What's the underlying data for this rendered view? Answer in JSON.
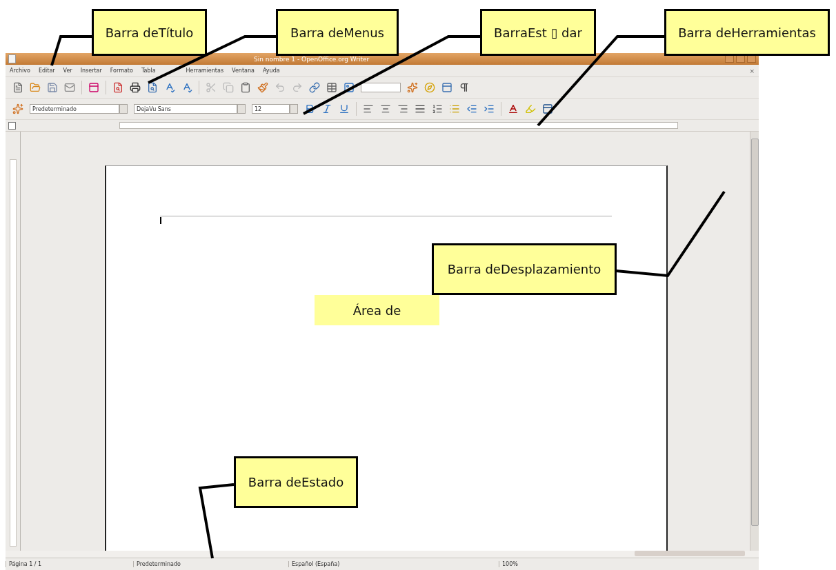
{
  "window": {
    "title": "Sin nombre 1 - OpenOffice.org Writer"
  },
  "menu_bar": {
    "items": [
      "Archivo",
      "Editar",
      "Ver",
      "Insertar",
      "Formato",
      "Tabla",
      "Herramientas",
      "Ventana",
      "Ayuda"
    ],
    "close": "×"
  },
  "formatting_toolbar": {
    "style": "Predeterminado",
    "font": "DejaVu Sans",
    "size": "12"
  },
  "status_bar": [
    "Página 1 / 1",
    "Predeterminado",
    "Español (España)",
    "100%"
  ],
  "annotations": [
    {
      "text": "Barra deTítulo"
    },
    {
      "text": "Barra deMenus"
    },
    {
      "text": "BarraEst ▯ dar"
    },
    {
      "text": "Barra deHerramientas"
    },
    {
      "text": "Barra deDesplazamiento"
    },
    {
      "text": "Área de",
      "kind": "plain"
    },
    {
      "text": "Barra deEstado"
    }
  ]
}
